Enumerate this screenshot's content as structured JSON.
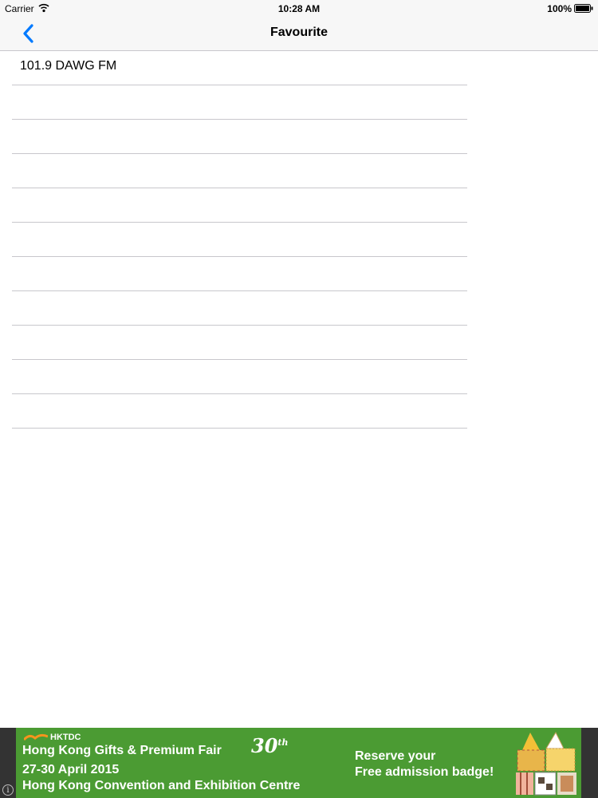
{
  "status_bar": {
    "carrier": "Carrier",
    "time": "10:28 AM",
    "battery": "100%"
  },
  "nav": {
    "title": "Favourite",
    "back_icon": "chevron-left-icon",
    "accent_color": "#007aff"
  },
  "list": {
    "items": [
      "101.9 DAWG FM",
      "",
      "",
      "",
      "",
      "",
      "",
      "",
      "",
      "",
      "",
      ""
    ]
  },
  "ad": {
    "brand": "HKTDC",
    "title": "Hong Kong Gifts & Premium Fair",
    "anniversary": "30",
    "anniversary_suffix": "th",
    "date": "27-30 April 2015",
    "venue": "Hong Kong Convention and Exhibition Centre",
    "cta_line1": "Reserve your",
    "cta_line2": "Free admission badge!",
    "info_glyph": "i",
    "background_color": "#4b9b33"
  }
}
